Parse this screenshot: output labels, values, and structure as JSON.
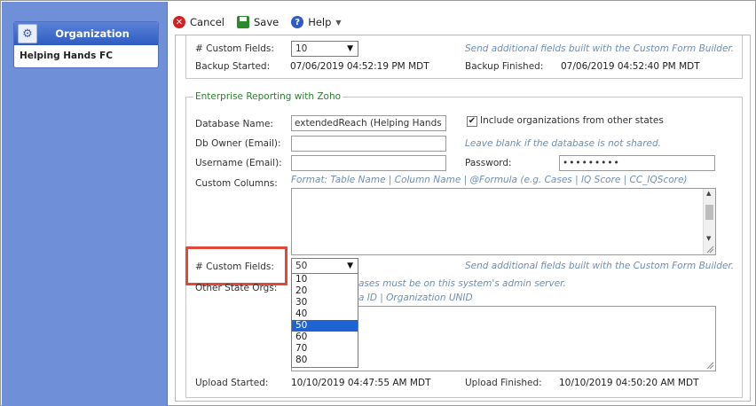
{
  "sidebar": {
    "org_header": "Organization",
    "org_name": "Helping Hands FC"
  },
  "toolbar": {
    "cancel_label": "Cancel",
    "save_label": "Save",
    "help_label": "Help"
  },
  "top_section": {
    "custom_fields_label": "# Custom Fields:",
    "custom_fields_value": "10",
    "custom_fields_hint": "Send additional fields built with the Custom Form Builder.",
    "backup_started_label": "Backup Started:",
    "backup_started_value": "07/06/2019 04:52:19 PM MDT",
    "backup_finished_label": "Backup Finished:",
    "backup_finished_value": "07/06/2019 04:52:40 PM MDT"
  },
  "zoho": {
    "legend": "Enterprise Reporting with Zoho",
    "db_name_label": "Database Name:",
    "db_name_value": "extendedReach (Helping Hands D",
    "include_orgs_label": "Include organizations from other states",
    "include_orgs_checked": true,
    "db_owner_label": "Db Owner (Email):",
    "db_owner_value": "",
    "db_owner_hint": "Leave blank if the database is not shared.",
    "username_label": "Username (Email):",
    "username_value": "",
    "password_label": "Password:",
    "password_value": "•••••••••",
    "custom_columns_label": "Custom Columns:",
    "custom_columns_hint": "Format: Table Name | Column Name | @Formula (e.g. Cases | IQ Score | CC_IQScore)",
    "custom_fields_label": "# Custom Fields:",
    "custom_fields_value": "50",
    "custom_fields_hint": "Send additional fields built with the Custom Form Builder.",
    "other_state_label": "Other State Orgs:",
    "other_state_hint1": "ases must be on this system's admin server.",
    "other_state_hint2": "a ID | Organization UNID",
    "upload_started_label": "Upload Started:",
    "upload_started_value": "10/10/2019 04:47:55 AM MDT",
    "upload_finished_label": "Upload Finished:",
    "upload_finished_value": "10/10/2019 04:50:20 AM MDT"
  },
  "dropdown": {
    "options": [
      "10",
      "20",
      "30",
      "40",
      "50",
      "60",
      "70",
      "80"
    ],
    "selected": "50"
  },
  "colors": {
    "sidebar_bg": "#6f90d8",
    "legend_green": "#2e7d32",
    "hint_blue": "#6e8fb5",
    "highlight_red": "#e0483a",
    "selected_blue": "#1e63d2"
  }
}
